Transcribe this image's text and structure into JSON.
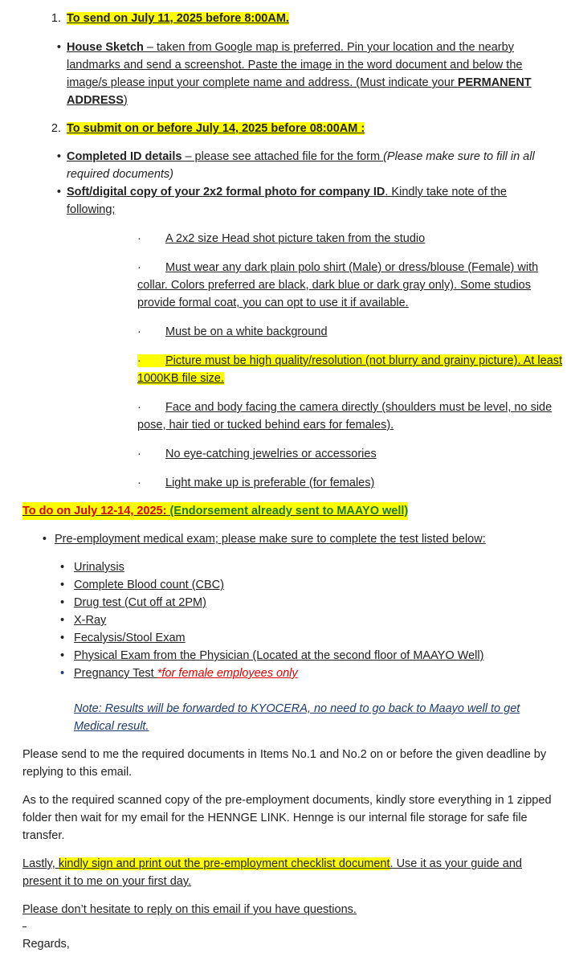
{
  "item1": {
    "number": "1.",
    "heading": "To send on July 11, 2025 before 8:00AM.",
    "house_sketch_label": "House Sketch",
    "house_sketch_text": " – taken from Google map is preferred. Pin your location and the nearby landmarks and send a screenshot. Paste the image in the word document and below the image/s please input your complete name and address. (Must indicate your ",
    "house_sketch_bold": "PERMANENT ADDRESS",
    "house_sketch_end": ")"
  },
  "item2": {
    "number": "2.",
    "heading": "To submit on or before July 14, 2025 before 08:00AM :",
    "id_label": "Completed ID details",
    "id_text": " – please see attached file for the form ",
    "id_note": "(Please make sure to fill in all required documents)",
    "photo_label": "Soft/digital copy of your 2x2 formal photo for company ID",
    "photo_text": ". Kindly take note of the following;",
    "photo_rules": [
      "A 2x2 size Head shot picture taken from the studio",
      "Must wear any dark plain polo shirt (Male) or dress/blouse (Female) with collar. Colors preferred are black, dark blue or dark gray only). Some studios provide formal coat, you can opt to use it if available.",
      "Must be on a white background",
      "Picture must be high quality/resolution (not blurry and grainy picture). At least 1000KB file size.",
      "Face and body facing the camera directly (shoulders must be level, no side pose, hair tied or tucked behind ears for females).",
      "No eye-catching jewelries or accessories",
      "Light make up is preferable (for females)"
    ]
  },
  "medical": {
    "heading_red": "To do on July 12-14, 2025: ",
    "heading_green": "(Endorsement already sent to MAAYO well)",
    "intro": "Pre-employment medical exam; please make sure to complete the test listed below:",
    "tests": [
      "Urinalysis",
      "Complete Blood count (CBC)",
      "Drug test (Cut off at 2PM)",
      "X-Ray",
      "Fecalysis/Stool Exam",
      "Physical Exam from the Physician (Located at the second floor of MAAYO Well)"
    ],
    "pregnancy_label": "Pregnancy Test ",
    "pregnancy_note": "*for female employees only",
    "note": "Note: Results will be forwarded to KYOCERA, no need to go back to Maayo well to get Medical result."
  },
  "paragraphs": {
    "send_docs": "Please send to me the required documents in Items No.1 and No.2 on or before the given deadline by replying to this email.",
    "scanned": "As to the required scanned copy of the pre-employment documents, kindly store everything in 1 zipped folder then wait for my email for the HENNGE LINK. Hennge is our internal file storage for safe file transfer.",
    "lastly_prefix": "Lastly, ",
    "lastly_highlight": "kindly sign and print out the pre-employment checklist document",
    "lastly_suffix": ". Use it as your guide and present it to me on your first day.",
    "questions": "Please don’t hesitate to reply on this email if you have questions.",
    "regards": "Regards,"
  },
  "rule_bullet": "·",
  "bullet": "•",
  "colors": {
    "highlight": "#ffff00",
    "red": "#e00000",
    "green": "#1e7a1e",
    "note_blue": "#1f3a6e"
  }
}
